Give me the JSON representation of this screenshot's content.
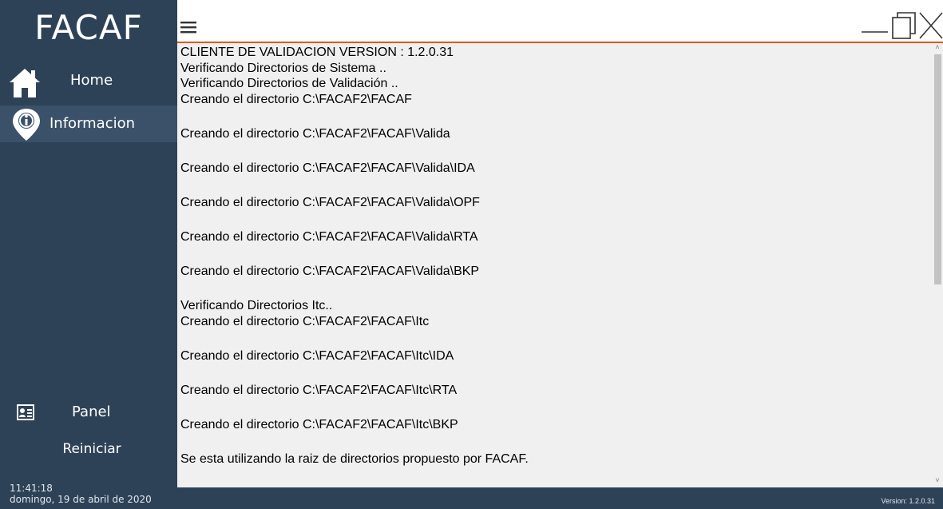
{
  "app": {
    "brand": "FACAF"
  },
  "sidebar": {
    "items": [
      {
        "label": "Home",
        "icon": "home-icon"
      },
      {
        "label": "Informacion",
        "icon": "info-pin-icon"
      },
      {
        "label": "Panel",
        "icon": "id-card-icon"
      },
      {
        "label": "Reiniciar"
      }
    ],
    "clock": {
      "time": "11:41:18",
      "date": "domingo, 19 de abril de 2020"
    }
  },
  "log": {
    "lines": [
      "CLIENTE DE VALIDACION VERSION : 1.2.0.31",
      "Verificando Directorios de Sistema ..",
      "Verificando Directorios de Validación ..",
      "Creando el directorio C:\\FACAF2\\FACAF",
      "",
      "Creando el directorio C:\\FACAF2\\FACAF\\Valida",
      "",
      "Creando el directorio C:\\FACAF2\\FACAF\\Valida\\IDA",
      "",
      "Creando el directorio C:\\FACAF2\\FACAF\\Valida\\OPF",
      "",
      "Creando el directorio C:\\FACAF2\\FACAF\\Valida\\RTA",
      "",
      "Creando el directorio C:\\FACAF2\\FACAF\\Valida\\BKP",
      "",
      "Verificando Directorios Itc..",
      "Creando el directorio C:\\FACAF2\\FACAF\\Itc",
      "",
      "Creando el directorio C:\\FACAF2\\FACAF\\Itc\\IDA",
      "",
      "Creando el directorio C:\\FACAF2\\FACAF\\Itc\\RTA",
      "",
      "Creando el directorio C:\\FACAF2\\FACAF\\Itc\\BKP",
      "",
      "Se esta utilizando la raiz de directorios propuesto por FACAF."
    ]
  },
  "status": {
    "version": "Version: 1.2.0.31"
  },
  "colors": {
    "sidebar": "#2e4257",
    "accent": "#e2581b",
    "active": "#3b5169"
  }
}
